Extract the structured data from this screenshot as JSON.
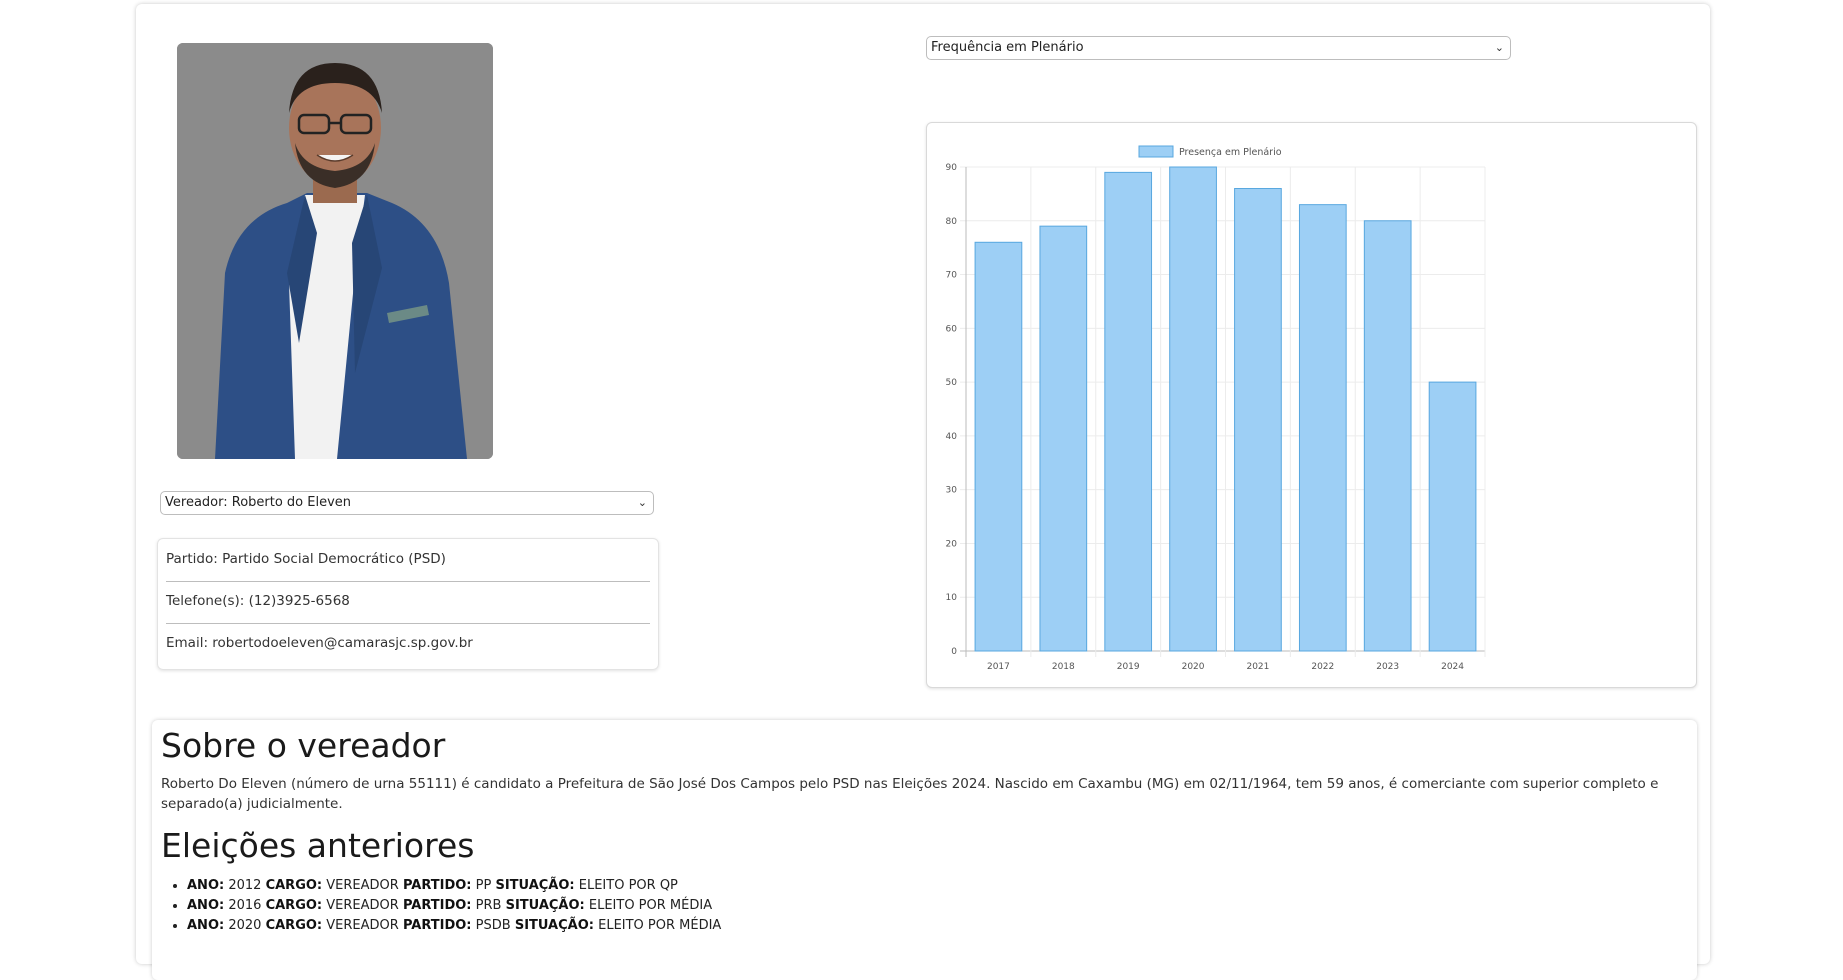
{
  "vereador_select": {
    "selected": "Vereador: Roberto do Eleven"
  },
  "info": {
    "partido": "Partido: Partido Social Democrático (PSD)",
    "telefone": "Telefone(s): (12)3925-6568",
    "email": "Email: robertodoeleven@camarasjc.sp.gov.br"
  },
  "metric_select": {
    "selected": "Frequência em Plenário"
  },
  "chart_data": {
    "type": "bar",
    "categories": [
      "2017",
      "2018",
      "2019",
      "2020",
      "2021",
      "2022",
      "2023",
      "2024"
    ],
    "series": [
      {
        "name": "Presença em Plenário",
        "values": [
          76,
          79,
          89,
          90,
          86,
          83,
          80,
          50
        ]
      }
    ],
    "ylim": [
      0,
      90
    ],
    "yticks": [
      0,
      10,
      20,
      30,
      40,
      50,
      60,
      70,
      80,
      90
    ],
    "grid": true,
    "legend": "top",
    "bar_fill": "#9dcff5",
    "bar_stroke": "#58a7df"
  },
  "about": {
    "title": "Sobre o vereador",
    "text": "Roberto Do Eleven (número de urna 55111) é candidato a Prefeitura de São José Dos Campos pelo PSD nas Eleições 2024. Nascido em Caxambu (MG) em 02/11/1964, tem 59 anos, é comerciante com superior completo e separado(a) judicialmente."
  },
  "elections": {
    "title": "Eleições anteriores",
    "labels": {
      "ano": "ANO:",
      "cargo": "CARGO:",
      "partido": "PARTIDO:",
      "situacao": "SITUAÇÃO:"
    },
    "items": [
      {
        "ano": "2012",
        "cargo": "VEREADOR",
        "partido": "PP",
        "situacao": "ELEITO POR QP"
      },
      {
        "ano": "2016",
        "cargo": "VEREADOR",
        "partido": "PRB",
        "situacao": "ELEITO POR MÉDIA"
      },
      {
        "ano": "2020",
        "cargo": "VEREADOR",
        "partido": "PSDB",
        "situacao": "ELEITO POR MÉDIA"
      }
    ]
  }
}
